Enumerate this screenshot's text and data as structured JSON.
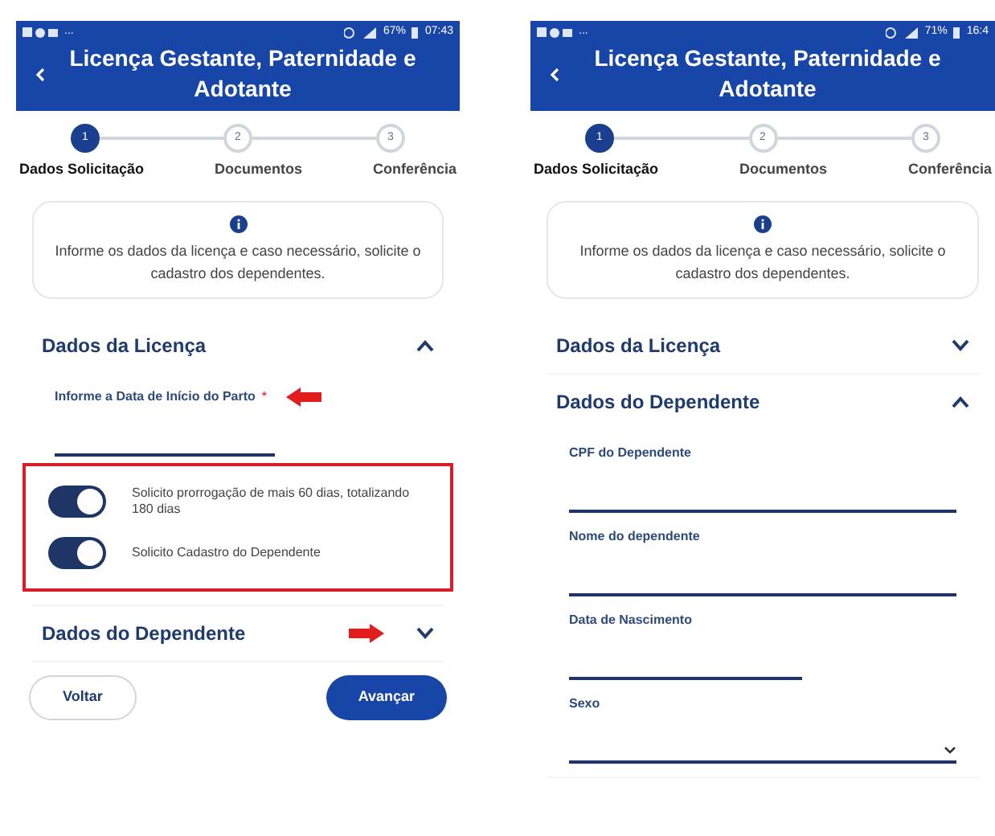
{
  "screens": [
    {
      "status": {
        "notifications": "...",
        "battery": "67%",
        "time": "07:43"
      },
      "title": "Licença Gestante, Paternidade e Adotante",
      "steps": [
        {
          "number": "1",
          "label": "Dados Solicitação",
          "selected": true
        },
        {
          "number": "2",
          "label": "Documentos",
          "selected": false
        },
        {
          "number": "3",
          "label": "Conferência",
          "selected": false
        }
      ],
      "info": "Informe os dados da licença e caso necessário, solicite o cadastro dos dependentes.",
      "sections": [
        {
          "title": "Dados da Licença",
          "expanded": true,
          "items": [
            {
              "kind": "date",
              "label": "Informe a Data de Início do Parto",
              "required": "*",
              "arrow": true
            },
            {
              "kind": "toggles",
              "highlighted": true,
              "toggles": [
                {
                  "label": "Solicito prorrogação de mais 60 dias, totalizando 180 dias",
                  "on": true
                },
                {
                  "label": "Solicito Cadastro do Dependente",
                  "on": true
                }
              ]
            }
          ]
        },
        {
          "title": "Dados do Dependente",
          "expanded": false,
          "arrow": true
        }
      ],
      "buttons": [
        {
          "label": "Voltar",
          "kind": "outline"
        },
        {
          "label": "Avançar",
          "kind": "primary"
        }
      ]
    },
    {
      "status": {
        "notifications": "...",
        "battery": "71%",
        "time": "16:4"
      },
      "title": "Licença Gestante, Paternidade e Adotante",
      "steps": [
        {
          "number": "1",
          "label": "Dados Solicitação",
          "selected": true
        },
        {
          "number": "2",
          "label": "Documentos",
          "selected": false
        },
        {
          "number": "3",
          "label": "Conferência",
          "selected": false
        }
      ],
      "info": "Informe os dados da licença e caso necessário, solicite o cadastro dos dependentes.",
      "sections": [
        {
          "title": "Dados da Licença",
          "expanded": false
        },
        {
          "title": "Dados do Dependente",
          "expanded": true,
          "items": [
            {
              "kind": "text",
              "label": "CPF do Dependente"
            },
            {
              "kind": "text",
              "label": "Nome do dependente"
            },
            {
              "kind": "date",
              "label": "Data de Nascimento"
            },
            {
              "kind": "select",
              "label": "Sexo"
            }
          ]
        }
      ]
    }
  ]
}
